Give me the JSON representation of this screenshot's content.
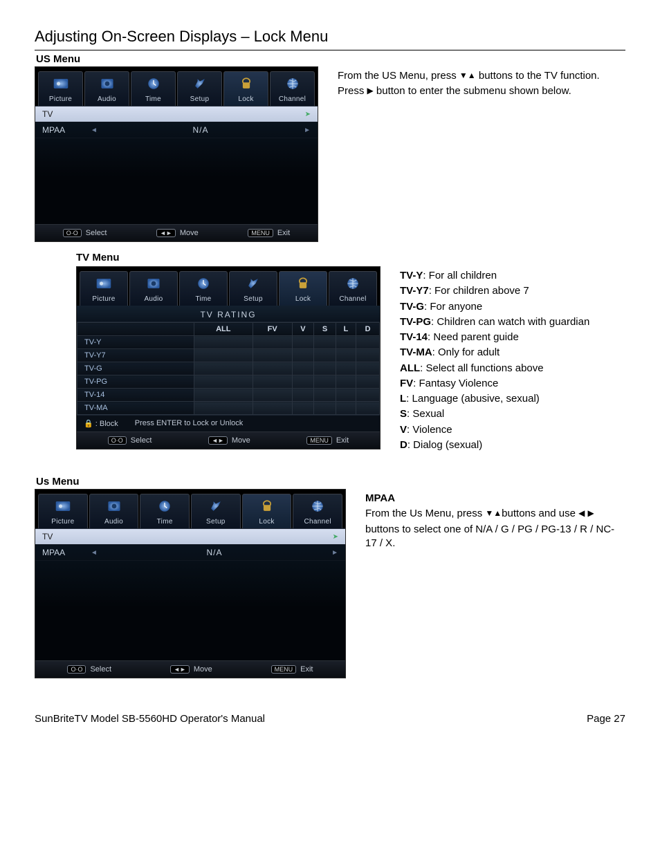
{
  "page_title": "Adjusting On-Screen Displays – Lock Menu",
  "sections": {
    "us1_label": "US Menu",
    "tv_label": "TV Menu",
    "us2_label": "Us Menu"
  },
  "tabs": [
    "Picture",
    "Audio",
    "Time",
    "Setup",
    "Lock",
    "Channel"
  ],
  "us_menu": {
    "rows": [
      {
        "key": "TV",
        "value": "",
        "selected": true,
        "right_arrow": true
      },
      {
        "key": "MPAA",
        "value": "N/A",
        "selected": false,
        "arrows": true
      }
    ]
  },
  "osd_foot": {
    "select": "Select",
    "move": "Move",
    "exit": "Exit",
    "menu_chip": "MENU"
  },
  "us_text": {
    "line1a": "From the US Menu, press ",
    "line1b": " buttons to the TV function.",
    "line2a": "Press ",
    "line2b": " button to enter the submenu shown below."
  },
  "tv_rating": {
    "title": "TV  RATING",
    "cols": [
      "",
      "ALL",
      "FV",
      "V",
      "S",
      "L",
      "D"
    ],
    "rows": [
      "TV-Y",
      "TV-Y7",
      "TV-G",
      "TV-PG",
      "TV-14",
      "TV-MA"
    ],
    "legend_block": ":  Block",
    "legend_hint": "Press  ENTER  to  Lock  or  Unlock"
  },
  "tv_defs": [
    {
      "term": "TV-Y",
      "desc": ": For all children"
    },
    {
      "term": "TV-Y7",
      "desc": ": For children above 7"
    },
    {
      "term": "TV-G",
      "desc": ": For anyone"
    },
    {
      "term": "TV-PG",
      "desc": ": Children can watch with guardian"
    },
    {
      "term": "TV-14",
      "desc": ": Need parent guide"
    },
    {
      "term": "TV-MA",
      "desc": ": Only for adult"
    },
    {
      "term": "ALL",
      "desc": ": Select all functions above"
    },
    {
      "term": "FV",
      "desc": ": Fantasy Violence"
    },
    {
      "term": "L",
      "desc": ": Language (abusive, sexual)"
    },
    {
      "term": "S",
      "desc": ": Sexual"
    },
    {
      "term": "V",
      "desc": ": Violence"
    },
    {
      "term": "D",
      "desc": ": Dialog (sexual)"
    }
  ],
  "mpaa": {
    "heading": "MPAA",
    "line1a": "From the Us Menu, press ",
    "line1b": "buttons and use ",
    "line2": "buttons to select one of N/A / G / PG / PG-13 / R / NC-17 / X."
  },
  "footer": {
    "left": "SunBriteTV Model SB-5560HD Operator's Manual",
    "right": "Page 27"
  }
}
